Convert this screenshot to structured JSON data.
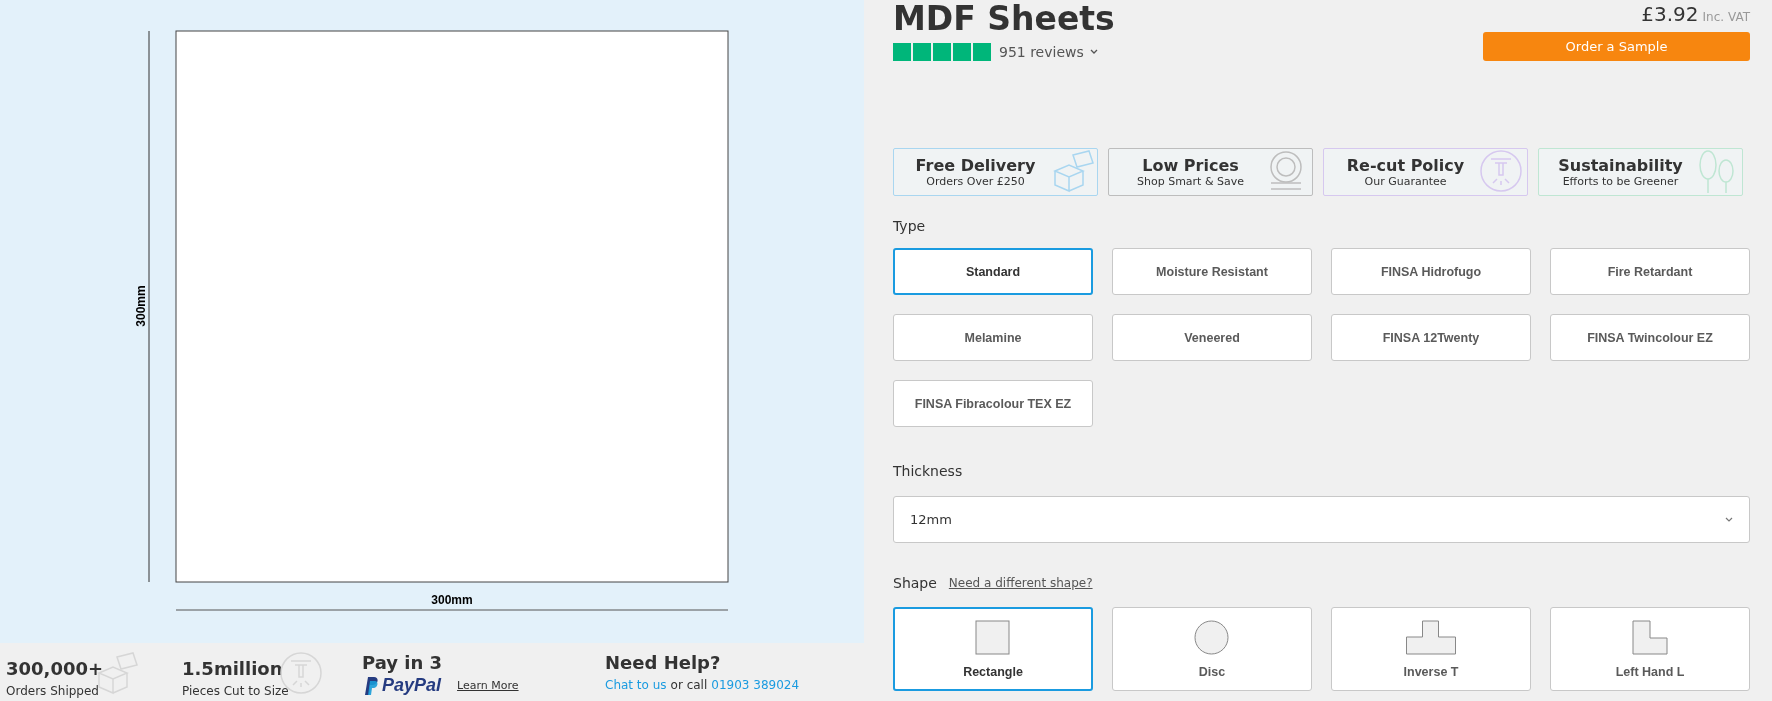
{
  "preview": {
    "height_label": "300mm",
    "width_label": "300mm"
  },
  "stats": [
    {
      "value": "300,000+",
      "label": "Orders Shipped",
      "kind": "parcels"
    },
    {
      "value": "1.5million",
      "label": "Pieces Cut to Size",
      "kind": "saw"
    }
  ],
  "pay": {
    "title": "Pay in 3",
    "brand": "PayPal",
    "link": "Learn More"
  },
  "help": {
    "title": "Need Help?",
    "link": "Chat to us",
    "text": "or call",
    "phone": "01903 389024"
  },
  "product": {
    "title": "MDF Sheets",
    "stars": 5,
    "reviews": "951 reviews",
    "price": "£3.92",
    "price_note": "Inc. VAT",
    "sample_button": "Order a Sample"
  },
  "features": [
    {
      "title": "Free Delivery",
      "subtitle": "Orders Over £250",
      "kind": "parcels",
      "color": "#a9d6f0"
    },
    {
      "title": "Low Prices",
      "subtitle": "Shop Smart & Save",
      "kind": "coins",
      "color": "#bdbdbd"
    },
    {
      "title": "Re-cut Policy",
      "subtitle": "Our Guarantee",
      "kind": "saw",
      "color": "#d6c8ef"
    },
    {
      "title": "Sustainability",
      "subtitle": "Efforts to be Greener",
      "kind": "trees",
      "color": "#bfe6d3"
    }
  ],
  "type": {
    "label": "Type",
    "options": [
      {
        "label": "Standard",
        "selected": true
      },
      {
        "label": "Moisture Resistant",
        "selected": false
      },
      {
        "label": "FINSA Hidrofugo",
        "selected": false
      },
      {
        "label": "Fire Retardant",
        "selected": false
      },
      {
        "label": "Melamine",
        "selected": false
      },
      {
        "label": "Veneered",
        "selected": false
      },
      {
        "label": "FINSA 12Twenty",
        "selected": false
      },
      {
        "label": "FINSA Twincolour EZ",
        "selected": false
      },
      {
        "label": "FINSA Fibracolour TEX EZ",
        "selected": false
      }
    ]
  },
  "thickness": {
    "label": "Thickness",
    "value": "12mm"
  },
  "shape": {
    "label": "Shape",
    "link": "Need a different shape?",
    "options": [
      {
        "label": "Rectangle",
        "kind": "rectangle",
        "selected": true
      },
      {
        "label": "Disc",
        "kind": "disc",
        "selected": false
      },
      {
        "label": "Inverse T",
        "kind": "inverse-t",
        "selected": false
      },
      {
        "label": "Left Hand L",
        "kind": "left-hand-l",
        "selected": false
      }
    ]
  }
}
